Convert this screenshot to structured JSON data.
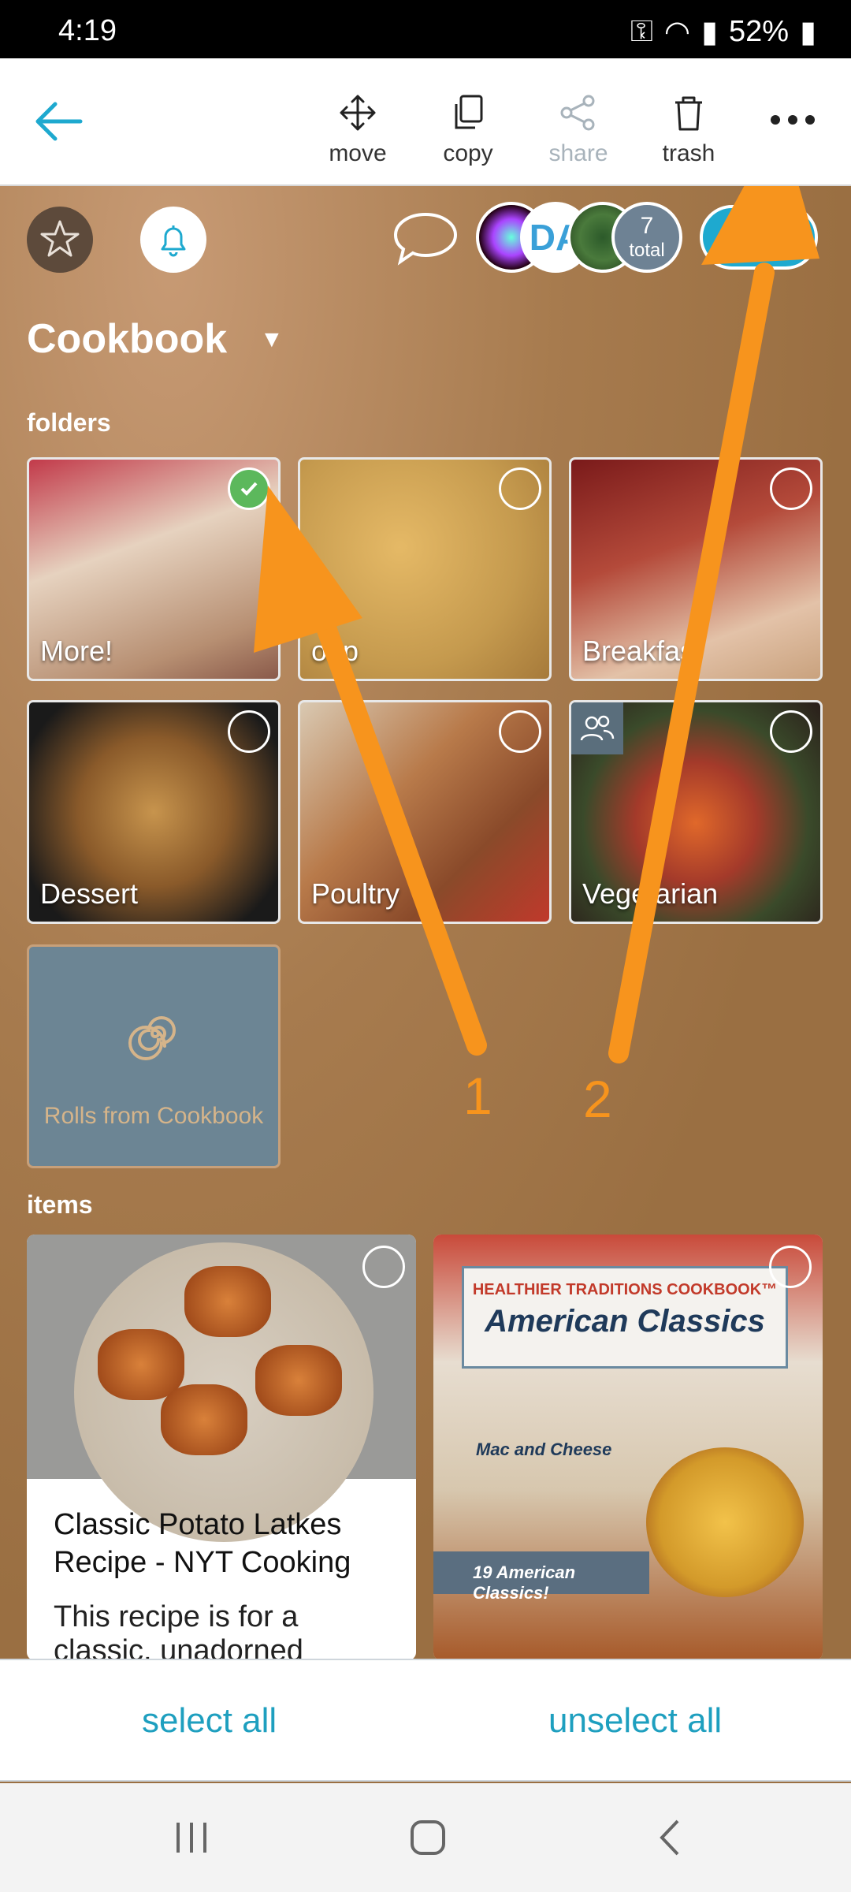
{
  "status": {
    "time": "4:19",
    "battery": "52%"
  },
  "toolbar": {
    "move": "move",
    "copy": "copy",
    "share": "share",
    "trash": "trash"
  },
  "header": {
    "total_count": "7",
    "total_label": "total",
    "avatar_text": "DA"
  },
  "page": {
    "title": "Cookbook"
  },
  "sections": {
    "folders": "folders",
    "items": "items"
  },
  "folders": [
    {
      "label": "More!",
      "selected": true
    },
    {
      "label": "oup",
      "selected": false
    },
    {
      "label": "Breakfas",
      "selected": false
    },
    {
      "label": "Dessert",
      "selected": false
    },
    {
      "label": "Poultry",
      "selected": false
    },
    {
      "label": "Vege arian",
      "selected": false
    }
  ],
  "rolls": {
    "label": "Rolls from Cookbook"
  },
  "items": [
    {
      "title": "Classic Potato Latkes Recipe - NYT Cooking",
      "desc": "This recipe is for a classic, unadorned"
    },
    {
      "banner_top": "HEALTHIER TRADITIONS COOKBOOK™",
      "banner_main": "American Classics",
      "tag1": "Mac and Cheese",
      "tag2": "19 American Classics!"
    }
  ],
  "bottom": {
    "select_all": "select all",
    "unselect_all": "unselect all"
  },
  "annotations": {
    "a1": "1",
    "a2": "2"
  },
  "colors": {
    "accent": "#1ea9cf",
    "arrow": "#f7941d",
    "background": "#9a6f42"
  }
}
